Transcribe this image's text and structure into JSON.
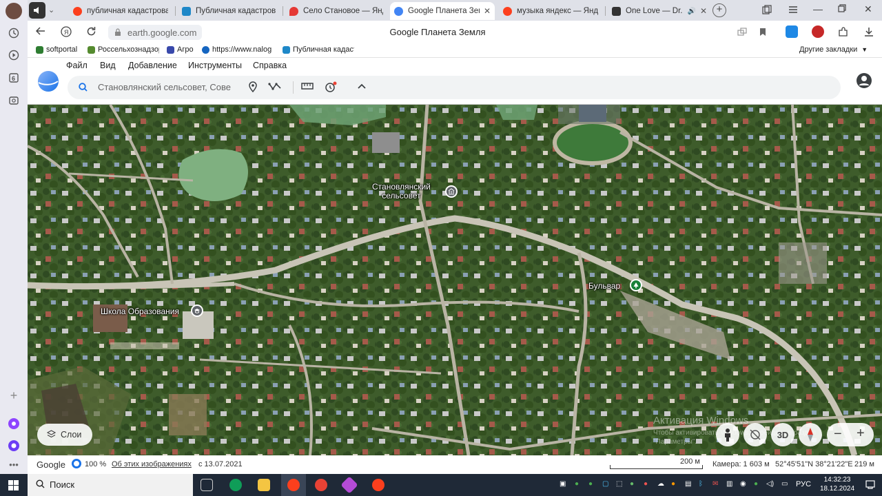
{
  "colors": {
    "tab_bg": "#dfe1e8",
    "active_tab": "#ffffff",
    "map_base": "#3d5a2a",
    "earth_accent": "#4285f4",
    "taskbar": "#1f2937"
  },
  "tabs": [
    {
      "label": "публичная кадастровая",
      "favicon": "yandex",
      "color": "#fc3f1d"
    },
    {
      "label": "Публичная кадастрова",
      "favicon": "rosreestr",
      "color": "#1e88c8"
    },
    {
      "label": "Село Становое — Янде",
      "favicon": "maps-pin",
      "color": "#e53935"
    },
    {
      "label": "Google Планета Земля",
      "favicon": "earth",
      "color": "#4285f4"
    },
    {
      "label": "музыка яндекс — Янде",
      "favicon": "yandex",
      "color": "#fc3f1d"
    },
    {
      "label": "One Love — Dr. Al",
      "favicon": "play",
      "color": "#333333"
    }
  ],
  "address": {
    "url": "earth.google.com",
    "page_title": "Google Планета Земля"
  },
  "bookmarks": [
    {
      "label": "softportal",
      "color": "#2e7d32"
    },
    {
      "label": "Россельхознадзор",
      "color": "#558b2f"
    },
    {
      "label": "Агро",
      "color": "#3949ab"
    },
    {
      "label": "https://www.nalog",
      "color": "#1565c0"
    },
    {
      "label": "Публичная кадаст",
      "color": "#1e88c8"
    }
  ],
  "other_bookmarks": "Другие закладки",
  "menu": [
    "Файл",
    "Вид",
    "Добавление",
    "Инструменты",
    "Справка"
  ],
  "search": {
    "value": "Становлянский сельсовет, Сове"
  },
  "map": {
    "labels": {
      "council": [
        "Становлянский",
        "сельсовет"
      ],
      "school": "Школа Образования",
      "boulevard": "Бульвар"
    },
    "layers_label": "Слои",
    "btn_3d": "3D",
    "watermark": [
      "Активация Windows",
      "Чтобы активировать Windows, перейдите в раздел",
      "\"Параметры\"."
    ]
  },
  "footer": {
    "brand": "Google",
    "percent": "100 %",
    "about": "Об этих изображениях",
    "date": "с 13.07.2021",
    "scale": "200 м",
    "camera": "Камера: 1 603 м",
    "coords": "52°45'51\"N 38°21'22\"E",
    "altitude": "219 м"
  },
  "taskbar": {
    "search": "Поиск",
    "lang": "РУС",
    "time": "14:32:23",
    "date": "18.12.2024"
  }
}
